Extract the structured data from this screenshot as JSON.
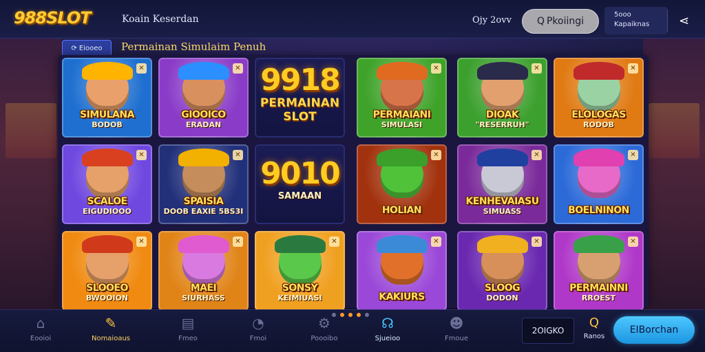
{
  "header": {
    "logo": "988SLOT",
    "nav_link": "Koain Keserdan",
    "user_label": "Ojy 2ovv",
    "search_button": "Pkoiingi",
    "account_line1": "5ooo",
    "account_line2": "Kapaiknas"
  },
  "section": {
    "badge": "Eiooeo",
    "title": "Permainan Simulaim Penuh"
  },
  "tiles": [
    {
      "name": "SIMULANA",
      "sub": "BODOB",
      "bg": "#1e6fd0",
      "hat": "#ffb400",
      "face": "#e9a06a"
    },
    {
      "name": "GIOOICO",
      "sub": "ERADAN",
      "bg": "#8a3cc8",
      "hat": "#2b8fff",
      "face": "#d9905f"
    },
    {
      "big": "9918",
      "sub": "PERMAINAN SLOT"
    },
    {
      "name": "PERMAIANI",
      "sub": "SIMULASI",
      "bg": "#3fa32a",
      "hat": "#e06a20",
      "face": "#d8744a"
    },
    {
      "name": "DIOAK",
      "sub": "\"RESERRUH\"",
      "bg": "#3ca02e",
      "hat": "#2a2a4a",
      "face": "#e2a06e"
    },
    {
      "name": "ELOLOGAS",
      "sub": "RODOB",
      "bg": "#e07a12",
      "hat": "#c02a2a",
      "face": "#9bd2a4"
    },
    {
      "name": "SCALOE",
      "sub": "EIGUDIOOO",
      "bg": "#6f48e0",
      "hat": "#d84020",
      "face": "#e6a06a"
    },
    {
      "name": "SPAISIA",
      "sub": "DOOB  EAXIE 5BS3I",
      "bg": "#22307a",
      "hat": "#f2b000",
      "face": "#c58d5c"
    },
    {
      "big": "9010",
      "sub": "SAMAAN"
    },
    {
      "name": "HOLIAN",
      "sub": "",
      "bg": "#a2320e",
      "hat": "#3aa02a",
      "face": "#4fc23a"
    },
    {
      "name": "KENHEVAIASU",
      "sub": "SIMUASS",
      "bg": "#7a2a9a",
      "hat": "#2040a0",
      "face": "#c9c9d6"
    },
    {
      "name": "BOELNINON",
      "sub": "",
      "bg": "#2c6ad8",
      "hat": "#e040b0",
      "face": "#e86ac8"
    },
    {
      "name": "SLOOEO",
      "sub": "BWOOION",
      "bg": "#f08a10",
      "hat": "#d03a1a",
      "face": "#e6a06a"
    },
    {
      "name": "MAEI",
      "sub": "SIURHASS",
      "bg": "#e08418",
      "hat": "#e05ad0",
      "face": "#d87ae0"
    },
    {
      "name": "SONSY",
      "sub": "KEIMIUASI",
      "bg": "#f0a020",
      "hat": "#2a7a40",
      "face": "#5ac84a"
    },
    {
      "name": "KAKIURS",
      "sub": "",
      "bg": "#9a48d8",
      "hat": "#3a8ad8",
      "face": "#e0702a"
    },
    {
      "name": "SLOOG",
      "sub": "DODON",
      "bg": "#6a28b0",
      "hat": "#f0b020",
      "face": "#d8905a"
    },
    {
      "name": "PERMAINNI",
      "sub": "RROEST",
      "bg": "#b038c8",
      "hat": "#38a048",
      "face": "#d8a070"
    }
  ],
  "bottom_nav": {
    "items": [
      {
        "icon": "home-icon",
        "glyph": "⌂",
        "label": "Eooioi"
      },
      {
        "icon": "edit-icon",
        "glyph": "✎",
        "label": "Nomaioaus"
      },
      {
        "icon": "document-icon",
        "glyph": "▤",
        "label": "Fmeo"
      },
      {
        "icon": "gauge-icon",
        "glyph": "◔",
        "label": "Fmoi"
      },
      {
        "icon": "gear-icon",
        "glyph": "⚙",
        "label": "Poooibo"
      },
      {
        "icon": "support-icon",
        "glyph": "☊",
        "label": "Sjueioo"
      },
      {
        "icon": "profile-icon",
        "glyph": "☻",
        "label": "Fmoue"
      }
    ],
    "balance": "2OIGKO",
    "promo_label": "Ranos",
    "cta_button": "EIBorchan"
  }
}
